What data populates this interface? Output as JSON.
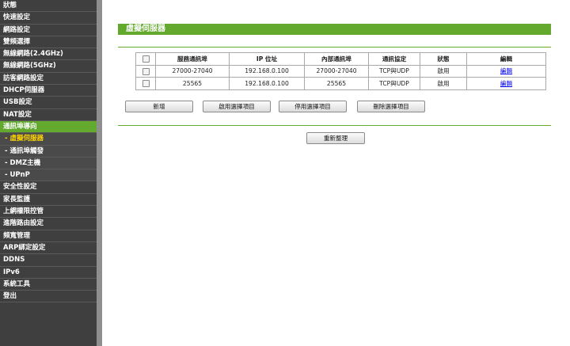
{
  "sidebar": {
    "items": [
      {
        "label": "狀態"
      },
      {
        "label": "快速設定"
      },
      {
        "label": "網路設定"
      },
      {
        "label": "雙頻選擇"
      },
      {
        "label": "無線網路(2.4GHz)"
      },
      {
        "label": "無線網路(5GHz)"
      },
      {
        "label": "訪客網路設定"
      },
      {
        "label": "DHCP伺服器"
      },
      {
        "label": "USB設定"
      },
      {
        "label": "NAT設定"
      },
      {
        "label": "通訊埠導向"
      },
      {
        "label": "- 虛擬伺服器"
      },
      {
        "label": "- 通訊埠觸發"
      },
      {
        "label": "- DMZ主機"
      },
      {
        "label": "- UPnP"
      },
      {
        "label": "安全性設定"
      },
      {
        "label": "家長監護"
      },
      {
        "label": "上網權限控管"
      },
      {
        "label": "進階路由設定"
      },
      {
        "label": "頻寬管理"
      },
      {
        "label": "ARP綁定設定"
      },
      {
        "label": "DDNS"
      },
      {
        "label": "IPv6"
      },
      {
        "label": "系統工具"
      },
      {
        "label": "登出"
      }
    ]
  },
  "page": {
    "title": "虛擬伺服器"
  },
  "table": {
    "headers": [
      "服務通訊埠",
      "IP 位址",
      "內部通訊埠",
      "通訊協定",
      "狀態",
      "編輯"
    ],
    "rows": [
      {
        "service_port": "27000-27040",
        "ip": "192.168.0.100",
        "internal_port": "27000-27040",
        "protocol": "TCP與UDP",
        "status": "啟用",
        "edit": "編輯"
      },
      {
        "service_port": "25565",
        "ip": "192.168.0.100",
        "internal_port": "25565",
        "protocol": "TCP與UDP",
        "status": "啟用",
        "edit": "編輯"
      }
    ]
  },
  "buttons": {
    "add": "新增",
    "enable_selected": "啟用選擇項目",
    "disable_selected": "停用選擇項目",
    "delete_selected": "刪除選擇項目",
    "refresh": "重新整理"
  },
  "colors": {
    "accent": "#62a92e",
    "sidebar_bg": "#3f3f3f",
    "current_sub_item": "#ffd400"
  }
}
